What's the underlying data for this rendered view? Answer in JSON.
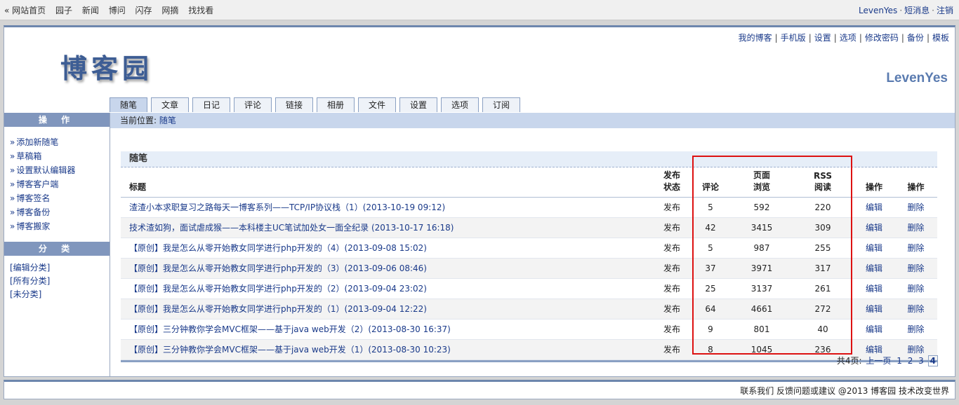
{
  "topbar": {
    "nav": [
      "« 网站首页",
      "园子",
      "新闻",
      "博问",
      "闪存",
      "网摘",
      "找找看"
    ],
    "user": "LevenYes",
    "messages": "短消息",
    "logout": "注销"
  },
  "header": {
    "links": [
      "我的博客",
      "手机版",
      "设置",
      "选项",
      "修改密码",
      "备份",
      "模板"
    ],
    "logo": "博客园",
    "blog_name": "LevenYes"
  },
  "tabs": [
    "随笔",
    "文章",
    "日记",
    "评论",
    "链接",
    "相册",
    "文件",
    "设置",
    "选项",
    "订阅"
  ],
  "breadcrumb": {
    "prefix": "当前位置:",
    "current": "随笔"
  },
  "sidebar": {
    "ops_title": "操  作",
    "ops": [
      "添加新随笔",
      "草稿箱",
      "设置默认编辑器",
      "博客客户端",
      "博客签名",
      "博客备份",
      "博客搬家"
    ],
    "cat_title": "分  类",
    "cats": [
      "[编辑分类]",
      "[所有分类]",
      "[未分类]"
    ]
  },
  "section": {
    "title": "随笔"
  },
  "table": {
    "headers": {
      "title": "标题",
      "status": "发布\n状态",
      "comments": "评论",
      "views": "页面\n浏览",
      "rss": "RSS\n阅读",
      "op1": "操作",
      "op2": "操作"
    },
    "rows": [
      {
        "title": "渣渣小本求职复习之路每天一博客系列——TCP/IP协议栈（1）(2013-10-19 09:12)",
        "status": "发布",
        "comments": "5",
        "views": "592",
        "rss": "220",
        "edit": "编辑",
        "delete": "删除"
      },
      {
        "title": "技术渣如狗，面试虐成猴——本科楼主UC笔试加处女一面全纪录 (2013-10-17 16:18)",
        "status": "发布",
        "comments": "42",
        "views": "3415",
        "rss": "309",
        "edit": "编辑",
        "delete": "删除"
      },
      {
        "title": "【原创】我是怎么从零开始教女同学进行php开发的（4）(2013-09-08 15:02)",
        "status": "发布",
        "comments": "5",
        "views": "987",
        "rss": "255",
        "edit": "编辑",
        "delete": "删除"
      },
      {
        "title": "【原创】我是怎么从零开始教女同学进行php开发的（3）(2013-09-06 08:46)",
        "status": "发布",
        "comments": "37",
        "views": "3971",
        "rss": "317",
        "edit": "编辑",
        "delete": "删除"
      },
      {
        "title": "【原创】我是怎么从零开始教女同学进行php开发的（2）(2013-09-04 23:02)",
        "status": "发布",
        "comments": "25",
        "views": "3137",
        "rss": "261",
        "edit": "编辑",
        "delete": "删除"
      },
      {
        "title": "【原创】我是怎么从零开始教女同学进行php开发的（1）(2013-09-04 12:22)",
        "status": "发布",
        "comments": "64",
        "views": "4661",
        "rss": "272",
        "edit": "编辑",
        "delete": "删除"
      },
      {
        "title": "【原创】三分钟教你学会MVC框架——基于java web开发（2）(2013-08-30 16:37)",
        "status": "发布",
        "comments": "9",
        "views": "801",
        "rss": "40",
        "edit": "编辑",
        "delete": "删除"
      },
      {
        "title": "【原创】三分钟教你学会MVC框架——基于java web开发（1）(2013-08-30 10:23)",
        "status": "发布",
        "comments": "8",
        "views": "1045",
        "rss": "236",
        "edit": "编辑",
        "delete": "删除"
      }
    ]
  },
  "pager": {
    "total": "共4页:",
    "prev": "上一页",
    "pages": [
      "1",
      "2",
      "3"
    ],
    "current": "4"
  },
  "footer": {
    "text": "联系我们 反馈问题或建议 @2013 博客园  技术改变世界"
  },
  "colors": {
    "header_blue": "#8096bd",
    "tab_active": "#c8d6ec",
    "highlight_red": "#dd1111"
  }
}
